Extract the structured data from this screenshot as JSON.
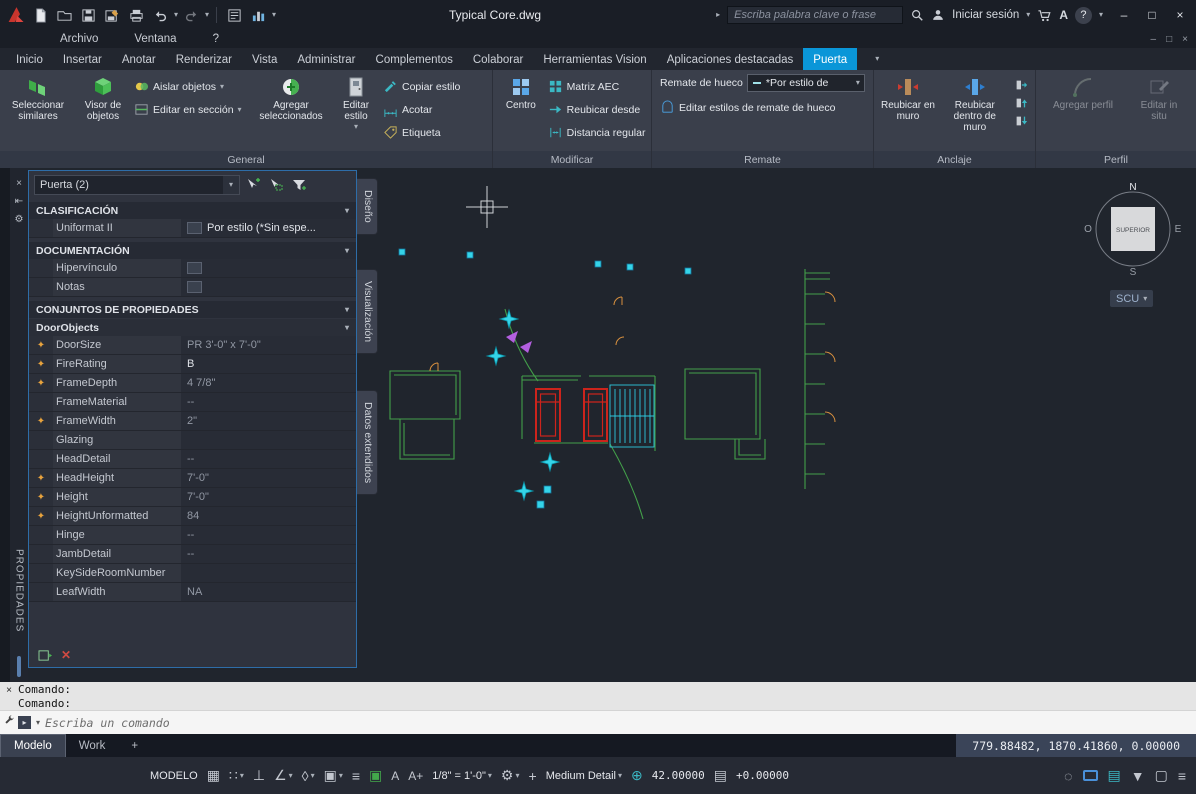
{
  "titlebar": {
    "doc_title": "Typical Core.dwg",
    "search_placeholder": "Escriba palabra clave o frase",
    "signin_label": "Iniciar sesión"
  },
  "menubar": {
    "items": [
      "Archivo",
      "Ventana",
      "?"
    ]
  },
  "ribbon": {
    "tabs": [
      "Inicio",
      "Insertar",
      "Anotar",
      "Renderizar",
      "Vista",
      "Administrar",
      "Complementos",
      "Colaborar",
      "Herramientas Vision",
      "Aplicaciones destacadas",
      "Puerta"
    ],
    "general": {
      "title": "General",
      "seleccionar_similares": "Seleccionar similares",
      "visor_objetos": "Visor de objetos",
      "aislar_objetos": "Aislar objetos",
      "editar_seccion": "Editar en sección",
      "agregar_seleccionados": "Agregar seleccionados",
      "editar_estilo": "Editar estilo",
      "copiar_estilo": "Copiar estilo",
      "acotar": "Acotar",
      "etiqueta": "Etiqueta"
    },
    "modificar": {
      "title": "Modificar",
      "centro": "Centro",
      "matriz_aec": "Matriz AEC",
      "reubicar_desde": "Reubicar desde",
      "distancia_regular": "Distancia regular"
    },
    "remate": {
      "title": "Remate",
      "remate_de_hueco": "Remate de hueco",
      "combo_value": "*Por estilo de",
      "editar_estilos": "Editar estilos de remate de hueco"
    },
    "anclaje": {
      "title": "Anclaje",
      "reubicar_en_muro": "Reubicar en muro",
      "reubicar_dentro": "Reubicar dentro de muro"
    },
    "perfil": {
      "title": "Perfil",
      "agregar_perfil": "Agregar perfil",
      "editar_in_situ": "Editar in situ"
    }
  },
  "palette": {
    "vertical_title": "PROPIEDADES",
    "selector_value": "Puerta (2)",
    "sec_clasificacion": "CLASIFICACIÓN",
    "uniformat_name": "Uniformat II",
    "uniformat_value": "Por estilo (*Sin espe...",
    "sec_documentacion": "DOCUMENTACIÓN",
    "hipervinculo": "Hipervínculo",
    "notas": "Notas",
    "sec_conjuntos": "CONJUNTOS DE PROPIEDADES",
    "sec_doorobjects": "DoorObjects",
    "door_rows": [
      {
        "name": "DoorSize",
        "value": "PR 3'-0\" x 7'-0\""
      },
      {
        "name": "FireRating",
        "value": "B"
      },
      {
        "name": "FrameDepth",
        "value": "4 7/8\""
      },
      {
        "name": "FrameMaterial",
        "value": "--"
      },
      {
        "name": "FrameWidth",
        "value": "2\""
      },
      {
        "name": "Glazing",
        "value": ""
      },
      {
        "name": "HeadDetail",
        "value": "--"
      },
      {
        "name": "HeadHeight",
        "value": "7'-0\""
      },
      {
        "name": "Height",
        "value": "7'-0\""
      },
      {
        "name": "HeightUnformatted",
        "value": "84"
      },
      {
        "name": "Hinge",
        "value": "--"
      },
      {
        "name": "JambDetail",
        "value": "--"
      },
      {
        "name": "KeySideRoomNumber",
        "value": ""
      },
      {
        "name": "LeafWidth",
        "value": "NA"
      }
    ]
  },
  "side_tabs": [
    "Diseño",
    "Visualización",
    "Datos extendidos"
  ],
  "viewport": {
    "compass_n": "N",
    "compass_s": "S",
    "compass_e": "E",
    "compass_o": "O",
    "cube_top": "SUPERIOR",
    "scu_label": "SCU"
  },
  "command": {
    "history_1": "Comando:",
    "history_2": "Comando:",
    "prompt_placeholder": "Escriba un comando"
  },
  "layout_tabs": {
    "model": "Modelo",
    "work": "Work",
    "add": "+"
  },
  "coordinates": "779.88482, 1870.41860, 0.00000",
  "status": {
    "modelo": "MODELO",
    "scale": "1/8\" = 1'-0\"",
    "detail": "Medium Detail",
    "elev1": "42.00000",
    "elev2": "+0.00000"
  },
  "icons": {
    "chevron_down": "▾",
    "chevron_right": "▸",
    "close": "×",
    "minimize": "–",
    "maximize": "□",
    "help": "?",
    "autodesk_a": "A",
    "grid": "▦",
    "snap": "∷",
    "ortho": "⊥",
    "polar": "∠",
    "iso": "◊",
    "osnap": "▣",
    "lineweight": "≡",
    "cycling": "▣",
    "annot_a": "A",
    "annot_plus": "A+",
    "gear": "⚙",
    "plus": "+",
    "globe": "⊕",
    "elev": "▤",
    "isolate": "◌",
    "layers": "▤",
    "filter": "▼",
    "clean": "▢",
    "menu": "≡",
    "autohide": "⇤"
  }
}
